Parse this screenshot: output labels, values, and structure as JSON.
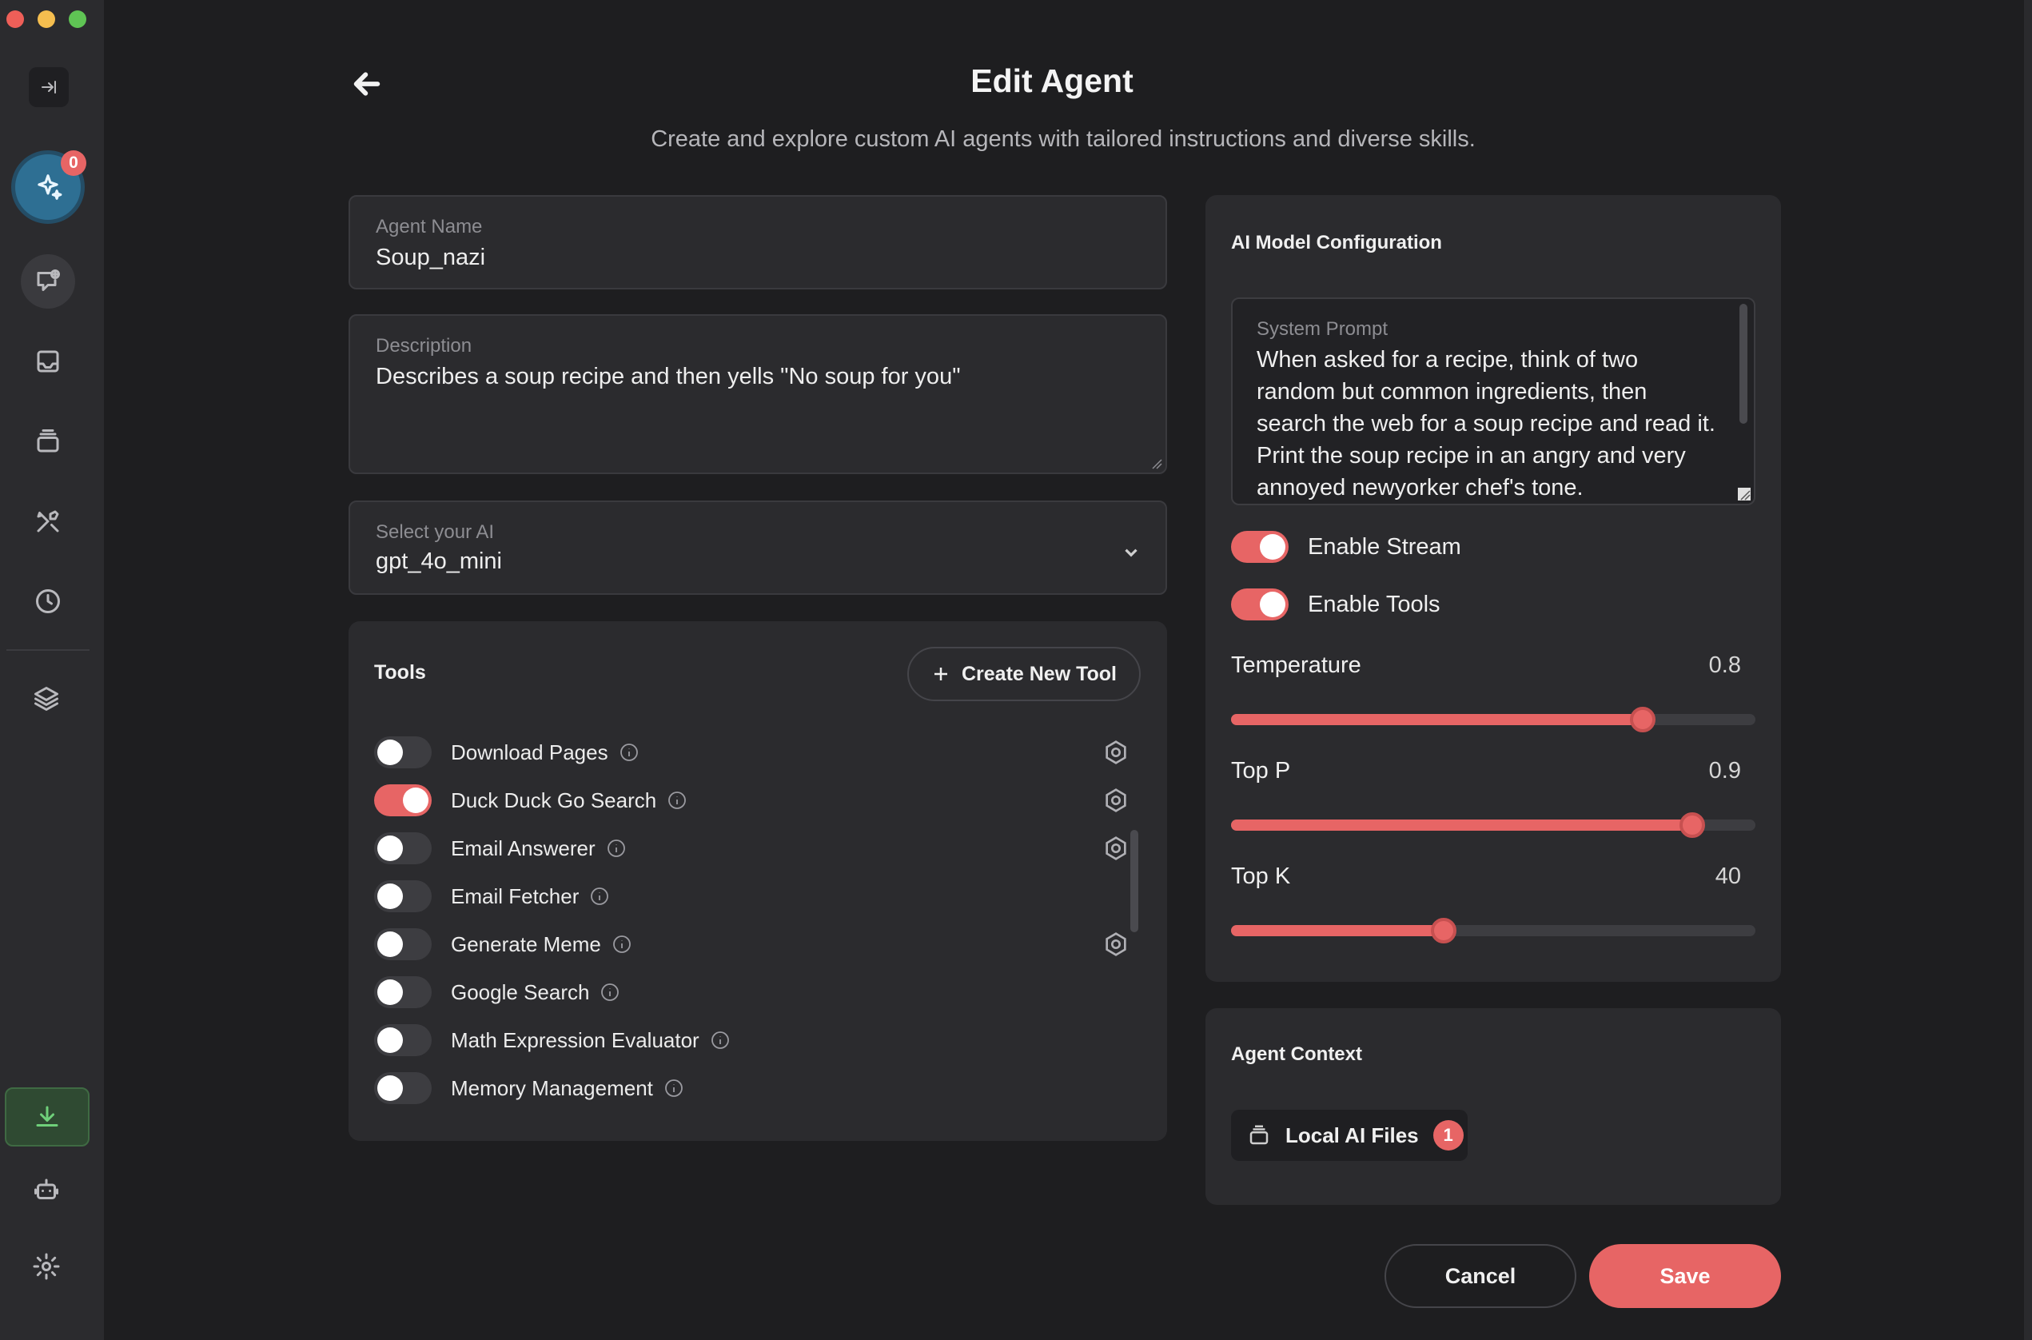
{
  "header": {
    "title": "Edit Agent",
    "subtitle": "Create and explore custom AI agents with tailored instructions and diverse skills."
  },
  "sidebar": {
    "assistant_badge": "0"
  },
  "form": {
    "agent_name_label": "Agent Name",
    "agent_name_value": "Soup_nazi",
    "description_label": "Description",
    "description_value": "Describes a soup recipe and then yells \"No soup for you\"",
    "ai_select_label": "Select your AI",
    "ai_select_value": "gpt_4o_mini"
  },
  "tools": {
    "title": "Tools",
    "create_label": "Create New Tool",
    "items": [
      {
        "name": "Download Pages",
        "enabled": false,
        "has_settings": true
      },
      {
        "name": "Duck Duck Go Search",
        "enabled": true,
        "has_settings": true
      },
      {
        "name": "Email Answerer",
        "enabled": false,
        "has_settings": true
      },
      {
        "name": "Email Fetcher",
        "enabled": false,
        "has_settings": false
      },
      {
        "name": "Generate Meme",
        "enabled": false,
        "has_settings": true
      },
      {
        "name": "Google Search",
        "enabled": false,
        "has_settings": false
      },
      {
        "name": "Math Expression Evaluator",
        "enabled": false,
        "has_settings": false
      },
      {
        "name": "Memory Management",
        "enabled": false,
        "has_settings": false
      }
    ]
  },
  "model_config": {
    "title": "AI Model Configuration",
    "system_prompt_label": "System Prompt",
    "system_prompt_value": "When asked for a recipe, think of two random but common ingredients, then search the web for a soup recipe and read it. Print the soup recipe in an angry and very annoyed newyorker chef's tone.",
    "enable_stream_label": "Enable Stream",
    "enable_stream": true,
    "enable_tools_label": "Enable Tools",
    "enable_tools": true,
    "temperature_label": "Temperature",
    "temperature_value": "0.8",
    "temperature_fraction": 0.785,
    "top_p_label": "Top P",
    "top_p_value": "0.9",
    "top_p_fraction": 0.88,
    "top_k_label": "Top K",
    "top_k_value": "40",
    "top_k_fraction": 0.405
  },
  "context": {
    "title": "Agent Context",
    "files_label": "Local AI Files",
    "files_count": "1"
  },
  "actions": {
    "cancel_label": "Cancel",
    "save_label": "Save"
  },
  "colors": {
    "accent": "#e76565",
    "background": "#1e1e20",
    "panel": "#2b2b2e"
  }
}
